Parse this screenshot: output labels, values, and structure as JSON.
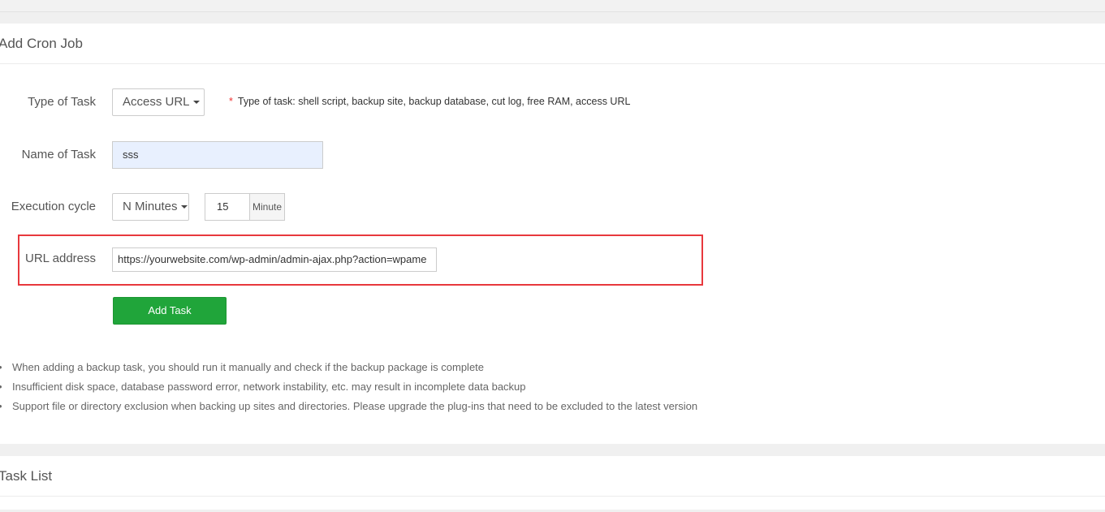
{
  "add_panel": {
    "title": "Add Cron Job",
    "type_label": "Type of Task",
    "type_value": "Access URL",
    "type_hint_star": "*",
    "type_hint": "Type of task: shell script, backup site, backup database, cut log, free RAM, access URL",
    "name_label": "Name of Task",
    "name_value": "sss",
    "cycle_label": "Execution cycle",
    "cycle_value": "N Minutes",
    "cycle_number": "15",
    "cycle_unit": "Minute",
    "url_label": "URL address",
    "url_value": "https://yourwebsite.com/wp-admin/admin-ajax.php?action=wpame",
    "add_button": "Add Task",
    "notes": [
      "When adding a backup task, you should run it manually and check if the backup package is complete",
      "Insufficient disk space, database password error, network instability, etc. may result in incomplete data backup",
      "Support file or directory exclusion when backing up sites and directories. Please upgrade the plug-ins that need to be excluded to the latest version"
    ]
  },
  "list_panel": {
    "title": "Task List"
  },
  "colors": {
    "accent_green": "#20a53a",
    "highlight_red": "#e8383d",
    "autofill_blue": "#e8f0fe"
  }
}
